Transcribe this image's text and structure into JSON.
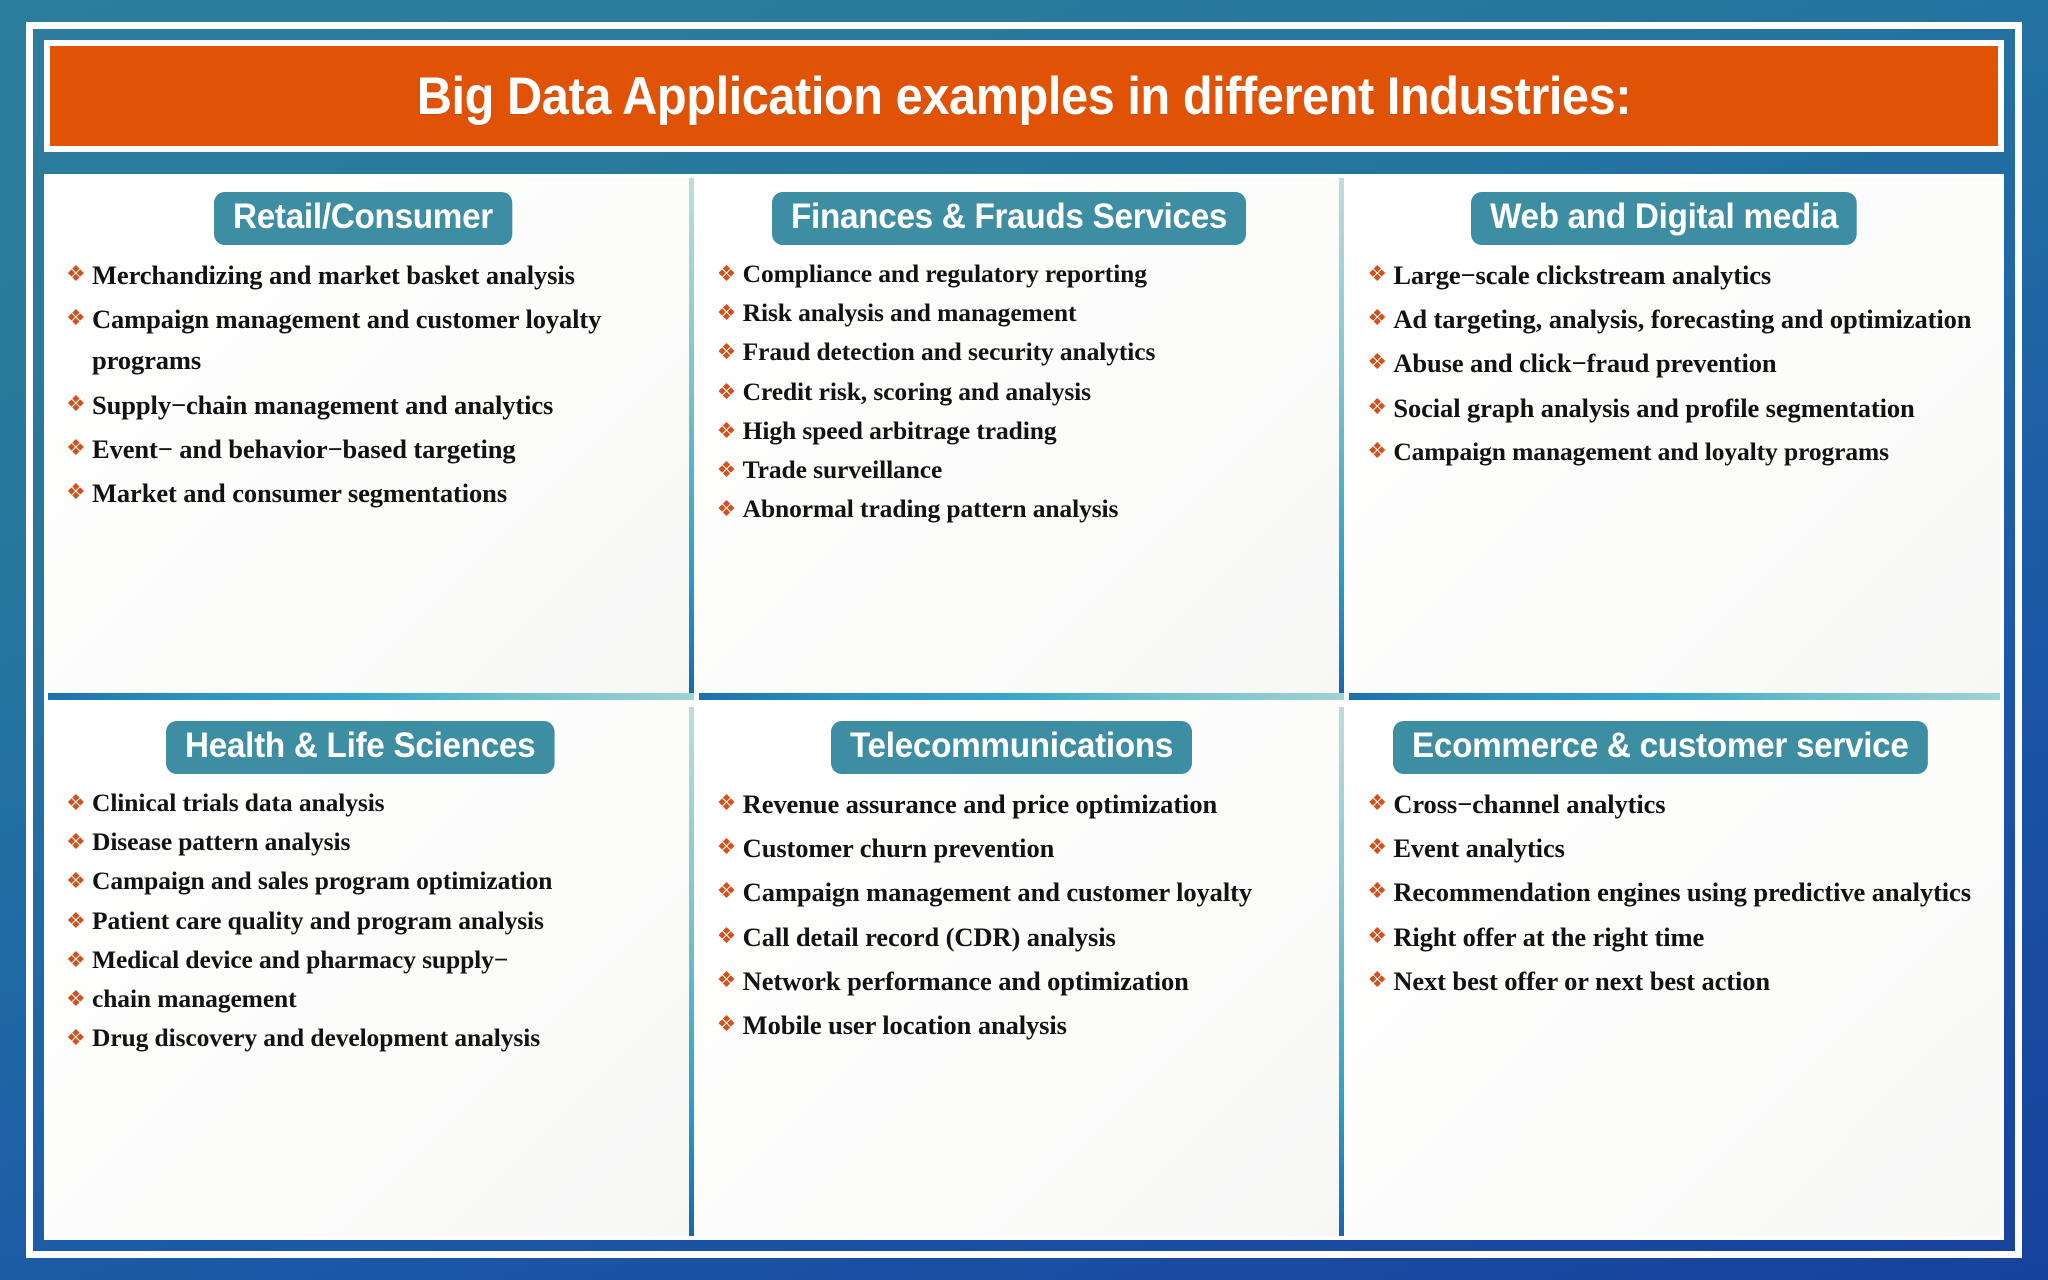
{
  "banner": {
    "title": "Big Data Application examples in different Industries:",
    "bg_color": "#e05206",
    "text_color": "#ffffff"
  },
  "theme": {
    "background_top_color": "#2a7a9b",
    "background_bottom_color": "#17429b",
    "header_badge_color": "#3d8da3",
    "bullet_color": "#d2511d",
    "panel_background": "#fbfbfa",
    "frame_color": "#ffffff"
  },
  "bullet_icon": "❖",
  "panels": [
    {
      "id": "retail-consumer",
      "title": "Retail/Consumer",
      "items": [
        "Merchandizing and market basket analysis",
        "Campaign management and customer loyalty programs",
        "Supply−chain management and analytics",
        "Event− and behavior−based targeting",
        "Market and consumer segmentations"
      ]
    },
    {
      "id": "finances-frauds-services",
      "title": "Finances & Frauds Services",
      "items": [
        "Compliance and regulatory reporting",
        "Risk analysis and management",
        "Fraud detection and security analytics",
        "Credit risk, scoring and analysis",
        "High speed arbitrage trading",
        "Trade surveillance",
        "Abnormal trading pattern analysis"
      ]
    },
    {
      "id": "web-and-digital-media",
      "title": "Web and Digital media",
      "items": [
        "Large−scale clickstream analytics",
        "Ad targeting, analysis, forecasting and optimization",
        "Abuse and click−fraud prevention",
        "Social graph analysis and profile segmentation",
        "Campaign management and loyalty programs"
      ]
    },
    {
      "id": "health-and-life-sciences",
      "title": "Health & Life Sciences",
      "items": [
        "Clinical trials data analysis",
        "Disease pattern analysis",
        "Campaign and sales program optimization",
        "Patient care quality and program analysis",
        "Medical device and pharmacy supply−",
        "chain management",
        "Drug discovery and development analysis"
      ]
    },
    {
      "id": "telecommunications",
      "title": "Telecommunications",
      "items": [
        "Revenue assurance and price optimization",
        "Customer churn prevention",
        "Campaign management and customer loyalty",
        "Call detail record (CDR) analysis",
        "Network performance and optimization",
        "Mobile user location analysis"
      ]
    },
    {
      "id": "ecommerce-customer-service",
      "title": "Ecommerce & customer service",
      "items": [
        "Cross−channel analytics",
        "Event analytics",
        "Recommendation engines using predictive analytics",
        "Right offer at the right time",
        "Next best offer or next best action"
      ]
    }
  ]
}
